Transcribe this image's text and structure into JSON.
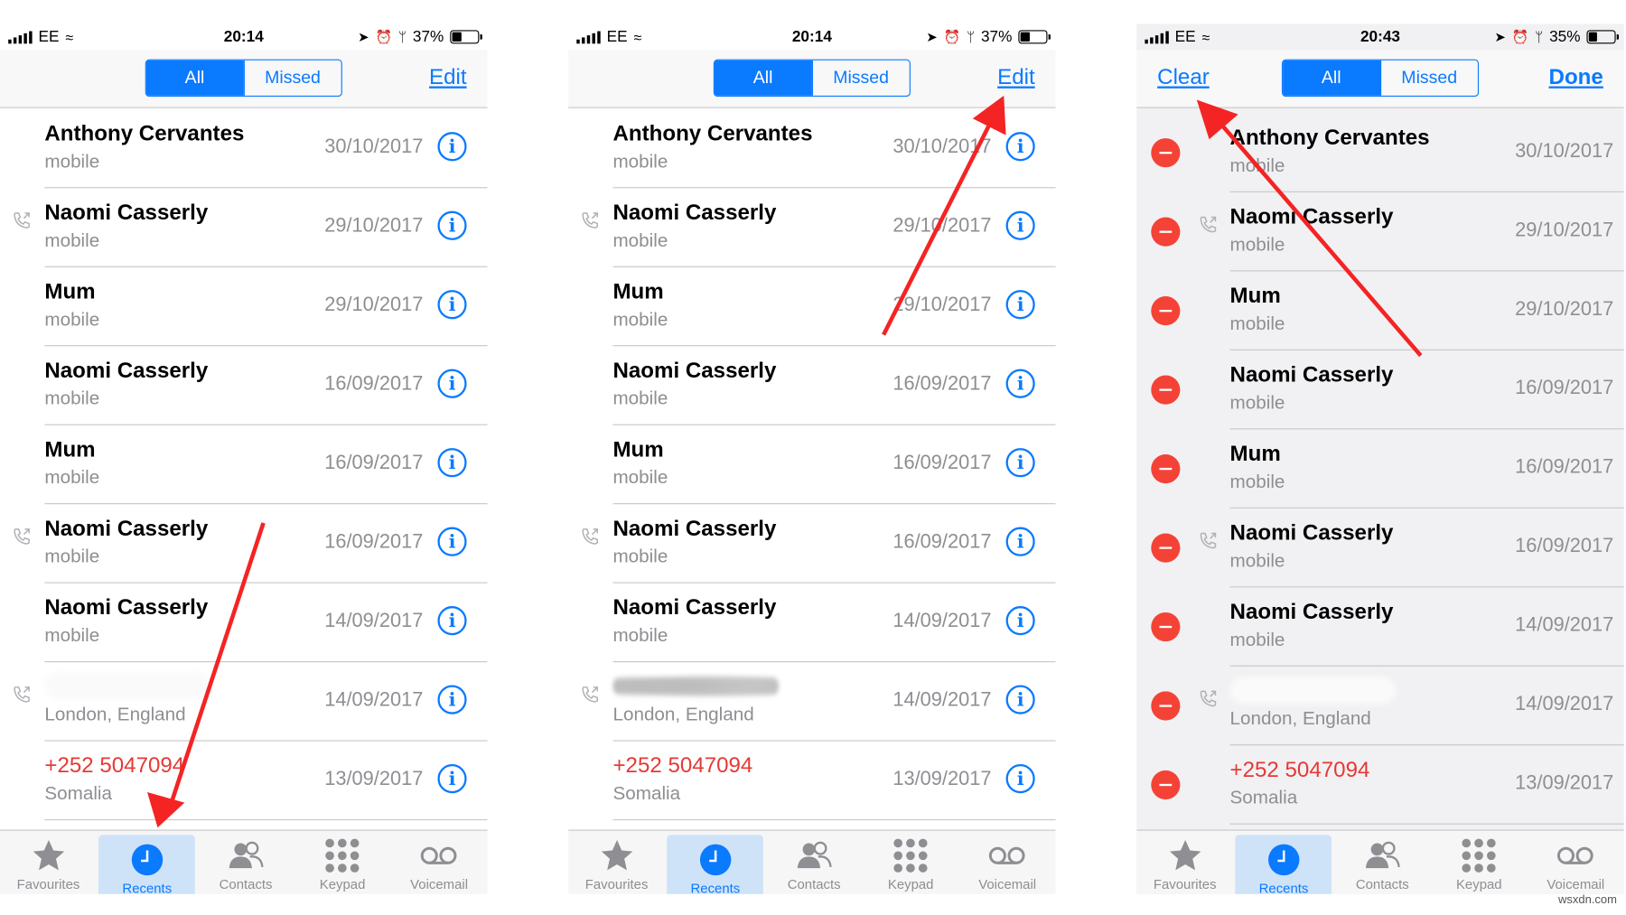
{
  "colors": {
    "accent": "#0a7aff",
    "missed": "#e53935",
    "annotation": "#f42424"
  },
  "watermark": "wsxdn.com",
  "tabs": [
    "Favourites",
    "Recents",
    "Contacts",
    "Keypad",
    "Voicemail"
  ],
  "row_sub_default": "mobile",
  "phones": [
    {
      "status": {
        "carrier": "EE",
        "time": "20:14",
        "battery": "37%"
      },
      "nav": {
        "seg_all": "All",
        "seg_missed": "Missed",
        "right": "Edit"
      },
      "rows": [
        {
          "name": "Anthony Cervantes",
          "sub": "mobile",
          "date": "30/10/2017"
        },
        {
          "name": "Naomi Casserly",
          "sub": "mobile",
          "date": "29/10/2017"
        },
        {
          "name": "Mum",
          "sub": "mobile",
          "date": "29/10/2017"
        },
        {
          "name": "Naomi Casserly",
          "sub": "mobile",
          "date": "16/09/2017"
        },
        {
          "name": "Mum",
          "sub": "mobile",
          "date": "16/09/2017"
        },
        {
          "name": "Naomi Casserly",
          "sub": "mobile",
          "date": "16/09/2017"
        },
        {
          "name": "Naomi Casserly",
          "sub": "mobile",
          "date": "14/09/2017"
        },
        {
          "name": "",
          "sub": "London, England",
          "date": "14/09/2017"
        },
        {
          "name": "+252 5047094",
          "sub": "Somalia",
          "date": "13/09/2017"
        }
      ]
    },
    {
      "status": {
        "carrier": "EE",
        "time": "20:14",
        "battery": "37%"
      },
      "nav": {
        "seg_all": "All",
        "seg_missed": "Missed",
        "right": "Edit"
      },
      "rows": [
        {
          "name": "Anthony Cervantes",
          "sub": "mobile",
          "date": "30/10/2017"
        },
        {
          "name": "Naomi Casserly",
          "sub": "mobile",
          "date": "29/10/2017"
        },
        {
          "name": "Mum",
          "sub": "mobile",
          "date": "29/10/2017"
        },
        {
          "name": "Naomi Casserly",
          "sub": "mobile",
          "date": "16/09/2017"
        },
        {
          "name": "Mum",
          "sub": "mobile",
          "date": "16/09/2017"
        },
        {
          "name": "Naomi Casserly",
          "sub": "mobile",
          "date": "16/09/2017"
        },
        {
          "name": "Naomi Casserly",
          "sub": "mobile",
          "date": "14/09/2017"
        },
        {
          "name": "",
          "sub": "London, England",
          "date": "14/09/2017"
        },
        {
          "name": "+252 5047094",
          "sub": "Somalia",
          "date": "13/09/2017"
        }
      ]
    },
    {
      "status": {
        "carrier": "EE",
        "time": "20:43",
        "battery": "35%"
      },
      "nav": {
        "left": "Clear",
        "seg_all": "All",
        "seg_missed": "Missed",
        "right": "Done"
      },
      "rows": [
        {
          "name": "Anthony Cervantes",
          "sub": "mobile",
          "date": "30/10/2017"
        },
        {
          "name": "Naomi Casserly",
          "sub": "mobile",
          "date": "29/10/2017"
        },
        {
          "name": "Mum",
          "sub": "mobile",
          "date": "29/10/2017"
        },
        {
          "name": "Naomi Casserly",
          "sub": "mobile",
          "date": "16/09/2017"
        },
        {
          "name": "Mum",
          "sub": "mobile",
          "date": "16/09/2017"
        },
        {
          "name": "Naomi Casserly",
          "sub": "mobile",
          "date": "16/09/2017"
        },
        {
          "name": "Naomi Casserly",
          "sub": "mobile",
          "date": "14/09/2017"
        },
        {
          "name": "",
          "sub": "London, England",
          "date": "14/09/2017"
        },
        {
          "name": "+252 5047094",
          "sub": "Somalia",
          "date": "13/09/2017"
        }
      ]
    }
  ]
}
